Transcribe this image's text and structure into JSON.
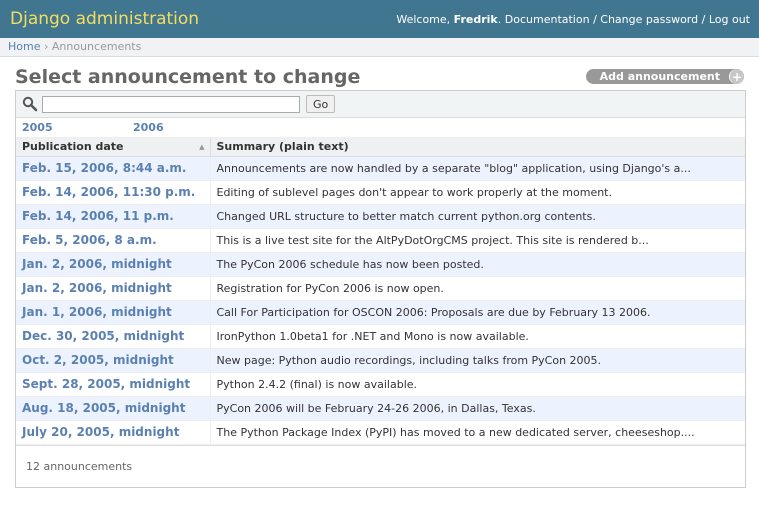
{
  "header": {
    "brand": "Django administration",
    "welcome_text": "Welcome,",
    "username": "Fredrik",
    "links": [
      "Documentation",
      "Change password",
      "Log out"
    ],
    "separator": " / "
  },
  "breadcrumbs": {
    "home": "Home",
    "separator": " › ",
    "current": "Announcements"
  },
  "page": {
    "title": "Select announcement to change",
    "add_button": "Add announcement",
    "add_button_icon": "+"
  },
  "search": {
    "value": "",
    "go_label": "Go"
  },
  "date_hierarchy": [
    "2005",
    "2006"
  ],
  "table": {
    "columns": [
      "Publication date",
      "Summary (plain text)"
    ],
    "rows": [
      {
        "date": "Feb. 15, 2006, 8:44 a.m.",
        "summary": "Announcements are now handled by a separate \"blog\" application, using Django's a..."
      },
      {
        "date": "Feb. 14, 2006, 11:30 p.m.",
        "summary": "Editing of sublevel pages don't appear to work properly at the moment."
      },
      {
        "date": "Feb. 14, 2006, 11 p.m.",
        "summary": "Changed URL structure to better match current python.org contents."
      },
      {
        "date": "Feb. 5, 2006, 8 a.m.",
        "summary": "This is a live test site for the AltPyDotOrgCMS project. This site is rendered b..."
      },
      {
        "date": "Jan. 2, 2006, midnight",
        "summary": "The PyCon 2006 schedule has now been posted."
      },
      {
        "date": "Jan. 2, 2006, midnight",
        "summary": "Registration for PyCon 2006 is now open."
      },
      {
        "date": "Jan. 1, 2006, midnight",
        "summary": "Call For Participation for OSCON 2006: Proposals are due by February 13 2006."
      },
      {
        "date": "Dec. 30, 2005, midnight",
        "summary": "IronPython 1.0beta1 for .NET and Mono is now available."
      },
      {
        "date": "Oct. 2, 2005, midnight",
        "summary": "New page: Python audio recordings, including talks from PyCon 2005."
      },
      {
        "date": "Sept. 28, 2005, midnight",
        "summary": "Python 2.4.2 (final) is now available."
      },
      {
        "date": "Aug. 18, 2005, midnight",
        "summary": "PyCon 2006 will be February 24-26 2006, in Dallas, Texas."
      },
      {
        "date": "July 20, 2005, midnight",
        "summary": "The Python Package Index (PyPI) has moved to a new dedicated server, cheeseshop...."
      }
    ]
  },
  "paginator": {
    "text": "12 announcements"
  },
  "colors": {
    "header_bg": "#417690",
    "brand": "#f5dd5d",
    "link": "#5b80b2",
    "row_alt": "#edf3fe"
  },
  "icons": {
    "search": "search-icon",
    "sort": "sort-ascending-icon",
    "add": "plus-icon"
  }
}
